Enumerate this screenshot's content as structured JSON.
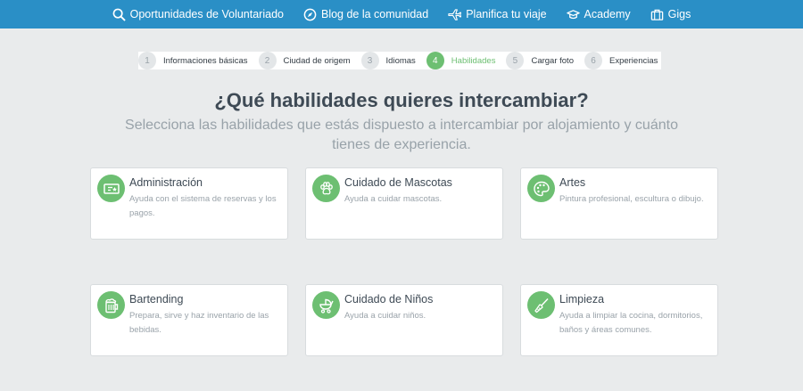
{
  "nav": {
    "items": [
      {
        "label": "Oportunidades de Voluntariado",
        "icon": "search-icon"
      },
      {
        "label": "Blog de la comunidad",
        "icon": "compass-icon"
      },
      {
        "label": "Planifica tu viaje",
        "icon": "plane-icon"
      },
      {
        "label": "Academy",
        "icon": "graduation-cap-icon"
      },
      {
        "label": "Gigs",
        "icon": "briefcase-icon"
      }
    ]
  },
  "stepper": {
    "steps": [
      {
        "num": "1",
        "label": "Informaciones básicas"
      },
      {
        "num": "2",
        "label": "Ciudad de origem"
      },
      {
        "num": "3",
        "label": "Idiomas"
      },
      {
        "num": "4",
        "label": "Habilidades"
      },
      {
        "num": "5",
        "label": "Cargar foto"
      },
      {
        "num": "6",
        "label": "Experiencias"
      }
    ],
    "active_step": 4
  },
  "heading": {
    "title": "¿Qué habilidades quieres intercambiar?",
    "subtitle": "Selecciona las habilidades que estás dispuesto a intercambiar por alojamiento y cuánto tienes de experiencia."
  },
  "skills": [
    {
      "title": "Administración",
      "desc": "Ayuda con el sistema de reservas y los pagos.",
      "icon": "ticket-icon"
    },
    {
      "title": "Cuidado de Mascotas",
      "desc": "Ayuda a cuidar mascotas.",
      "icon": "paw-icon"
    },
    {
      "title": "Artes",
      "desc": "Pintura profesional, escultura o dibujo.",
      "icon": "palette-icon"
    },
    {
      "title": "Bartending",
      "desc": "Prepara, sirve y haz inventario de las bebidas.",
      "icon": "beer-mug-icon"
    },
    {
      "title": "Cuidado de Niños",
      "desc": "Ayuda a cuidar niños.",
      "icon": "stroller-icon"
    },
    {
      "title": "Limpieza",
      "desc": "Ayuda a limpiar la cocina, dormitorios, baños y áreas comunes.",
      "icon": "broom-icon"
    }
  ],
  "colors": {
    "nav_bg": "#2a8fc6",
    "accent_green": "#6dbf72",
    "page_bg": "#e9ebec"
  }
}
